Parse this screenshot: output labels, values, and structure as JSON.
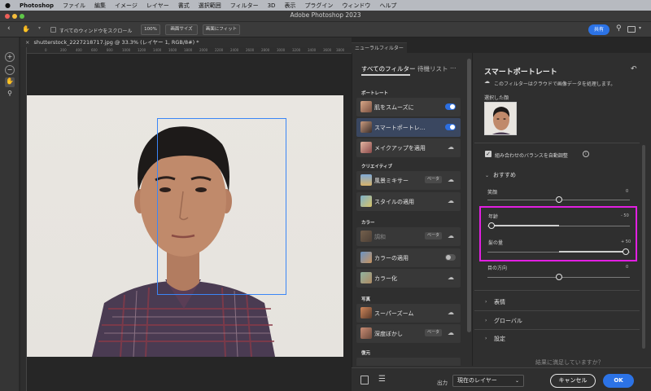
{
  "menubar": {
    "apple": "",
    "items": [
      "Photoshop",
      "ファイル",
      "編集",
      "イメージ",
      "レイヤー",
      "書式",
      "選択範囲",
      "フィルター",
      "3D",
      "表示",
      "プラグイン",
      "ウィンドウ",
      "ヘルプ"
    ]
  },
  "window": {
    "title": "Adobe Photoshop 2023"
  },
  "options": {
    "scroll_all_label": "すべてのウィンドウをスクロール",
    "zoom_label": "100%",
    "fit_screen_label": "画面サイズ",
    "fill_screen_label": "画面にフィット",
    "share_label": "共有"
  },
  "document": {
    "tab_label": "shutterstock_2227218717.jpg @ 33.3% (レイヤー 1, RGB/8#) *",
    "ruler_ticks": [
      "0",
      "200",
      "400",
      "600",
      "800",
      "1000",
      "1200",
      "1400",
      "1600",
      "1800",
      "2000",
      "2200",
      "2400",
      "2600",
      "2800",
      "3000",
      "3200",
      "3400",
      "3600",
      "3800",
      "4000"
    ]
  },
  "neural_filters": {
    "panel_tab": "ニューラルフィルター",
    "list_header": "すべてのフィルター",
    "list_header_tab": "待機リスト",
    "more_label": "…",
    "sections": {
      "portrait": "ポートレート",
      "creative": "クリエイティブ",
      "color": "カラー",
      "photo": "写真",
      "restore": "復元"
    },
    "filters": {
      "skin": "肌をスムーズに",
      "smart_portrait": "スマートポートレ...",
      "makeup": "メイクアップを適用",
      "landscape": "風景ミキサー",
      "style": "スタイルの適用",
      "harmonize": "調和",
      "color_transfer": "カラーの適用",
      "colorize": "カラー化",
      "superzoom": "スーパーズーム",
      "depth_blur": "深度ぼかし"
    },
    "beta_label": "ベータ"
  },
  "settings": {
    "title": "スマートポートレート",
    "cloud_note": "このフィルターはクラウドで画像データを処理します。",
    "selected_face_label": "選択した顔",
    "auto_balance_label": "組み合わせのバランスを自動調整",
    "recommended_label": "おすすめ",
    "sliders": {
      "smile_label": "笑顔",
      "smile_value": "0",
      "smile_fraction": 0.5,
      "age_label": "年齢",
      "age_value": "- 50",
      "age_fraction": 0.0,
      "hair_label": "髪の量",
      "hair_value": "+ 50",
      "hair_fraction": 1.0,
      "eye_label": "目の方向",
      "eye_value": "0",
      "eye_fraction": 0.5
    },
    "groups": {
      "expression": "表情",
      "global": "グローバル",
      "settings": "設定"
    },
    "feedback": "結果に満足していますか？"
  },
  "bottom": {
    "output_label": "出力",
    "output_value": "現在のレイヤー",
    "cancel_label": "キャンセル",
    "ok_label": "OK"
  },
  "colors": {
    "accent": "#2c73e6",
    "highlight": "#e21fe2",
    "selection": "#3b86f6"
  }
}
